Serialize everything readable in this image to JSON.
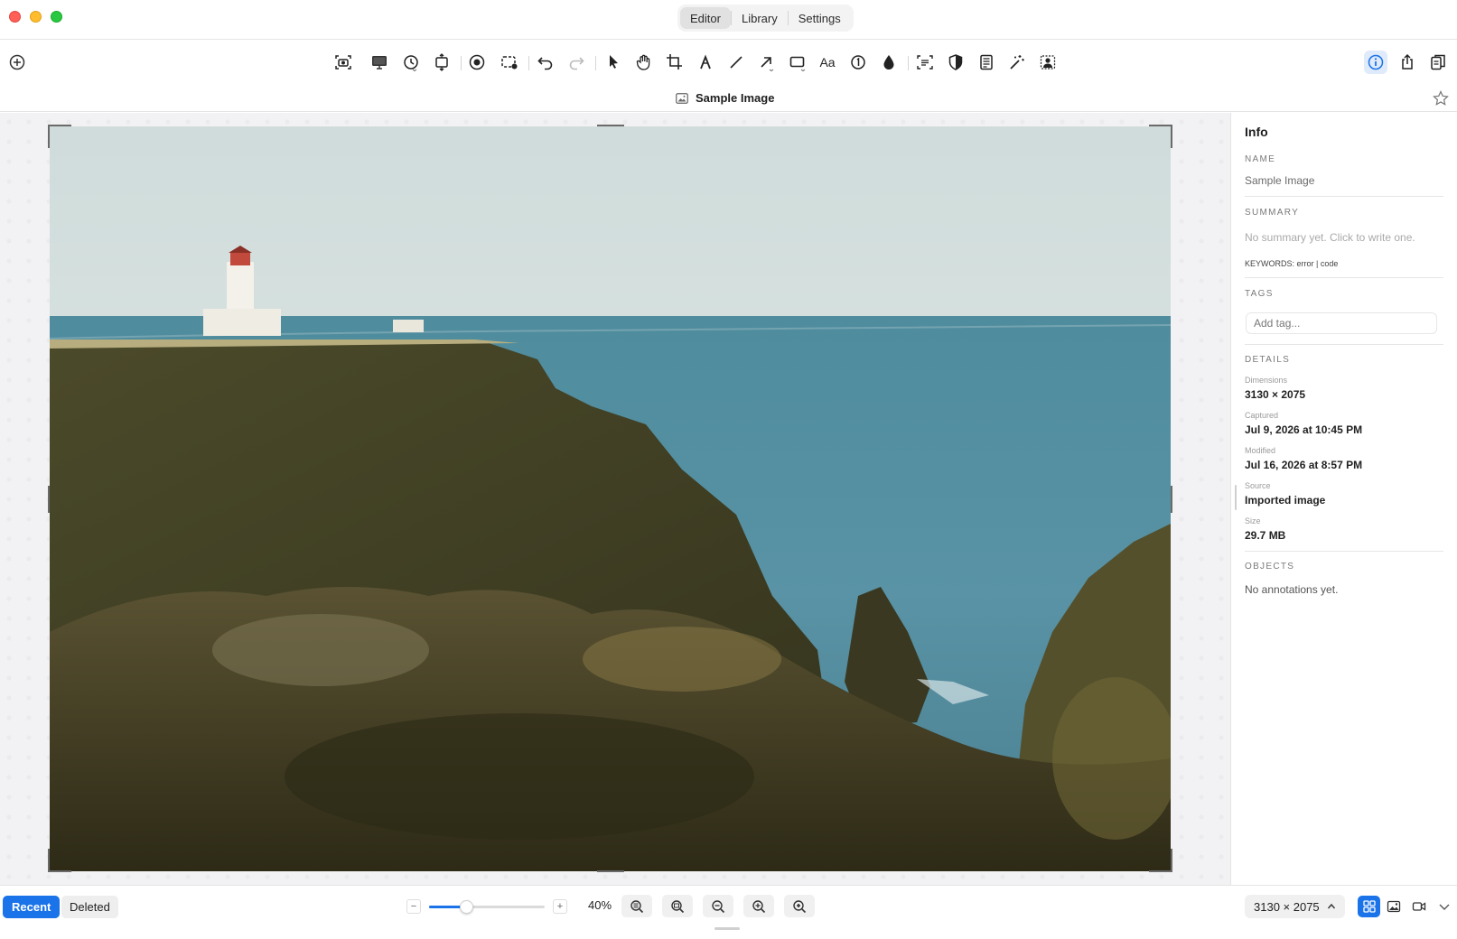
{
  "window": {
    "tabs": [
      {
        "label": "Editor",
        "active": true
      },
      {
        "label": "Library",
        "active": false
      },
      {
        "label": "Settings",
        "active": false
      }
    ]
  },
  "toolbar": {
    "text_tool_label": "Aa",
    "icons": [
      "add-circle-icon",
      "screenshot-icon",
      "monitor-icon",
      "timer-icon",
      "scroll-capture-icon",
      "record-icon",
      "region-record-icon",
      "undo-icon",
      "redo-icon",
      "pointer-icon",
      "hand-icon",
      "crop-icon",
      "pen-icon",
      "line-icon",
      "arrow-icon",
      "rectangle-icon",
      "text-icon",
      "counter-icon",
      "blur-icon",
      "ocr-icon",
      "highlight-icon",
      "notes-icon",
      "magic-wand-icon",
      "background-removal-icon",
      "info-icon",
      "share-icon",
      "copy-icon"
    ]
  },
  "document": {
    "title": "Sample Image"
  },
  "info": {
    "title": "Info",
    "name_label": "NAME",
    "name_value": "Sample Image",
    "summary_label": "SUMMARY",
    "summary_placeholder": "No summary yet. Click to write one.",
    "keywords": "KEYWORDS: error | code",
    "tags_label": "TAGS",
    "tags_placeholder": "Add tag...",
    "details_label": "DETAILS",
    "details": [
      {
        "caption": "Dimensions",
        "value": "3130 × 2075"
      },
      {
        "caption": "Captured",
        "value": "Jul 9, 2026 at 10:45 PM"
      },
      {
        "caption": "Modified",
        "value": "Jul 16, 2026 at 8:57 PM"
      },
      {
        "caption": "Source",
        "value": "Imported image"
      },
      {
        "caption": "Size",
        "value": "29.7 MB"
      }
    ],
    "objects_label": "OBJECTS",
    "objects_empty": "No annotations yet."
  },
  "bottom": {
    "recent_label": "Recent",
    "deleted_label": "Deleted",
    "zoom_minus": "−",
    "zoom_plus": "+",
    "zoom_fraction": 0.32,
    "zoom_text": "40%",
    "dimensions_button": "3130 × 2075"
  },
  "colors": {
    "accent": "#1a73e8",
    "close": "#ff5f57",
    "minimize": "#febc2e",
    "maximize": "#28c840"
  }
}
